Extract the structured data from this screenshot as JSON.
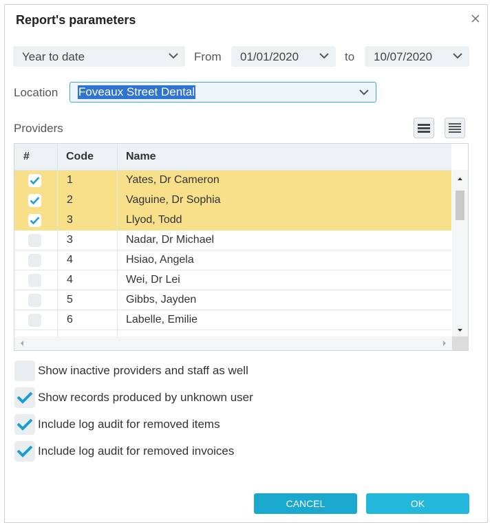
{
  "dialog": {
    "title": "Report's parameters"
  },
  "period": {
    "range": "Year to date",
    "from_label": "From",
    "from": "01/01/2020",
    "to_label": "to",
    "to": "10/07/2020"
  },
  "location": {
    "label": "Location",
    "value": "Foveaux Street Dental"
  },
  "providers": {
    "label": "Providers",
    "columns": {
      "check": "#",
      "code": "Code",
      "name": "Name"
    },
    "rows": [
      {
        "code": "1",
        "name": "Yates, Dr Cameron",
        "checked": true
      },
      {
        "code": "2",
        "name": "Vaguine, Dr Sophia",
        "checked": true
      },
      {
        "code": "3",
        "name": "Llyod, Todd",
        "checked": true
      },
      {
        "code": "3",
        "name": "Nadar, Dr Michael",
        "checked": false
      },
      {
        "code": "4",
        "name": "Hsiao, Angela",
        "checked": false
      },
      {
        "code": "4",
        "name": "Wei, Dr Lei",
        "checked": false
      },
      {
        "code": "5",
        "name": "Gibbs, Jayden",
        "checked": false
      },
      {
        "code": "6",
        "name": "Labelle, Emilie",
        "checked": false
      }
    ]
  },
  "options": [
    {
      "label": "Show inactive providers and staff as well",
      "checked": false
    },
    {
      "label": "Show records produced by unknown user",
      "checked": true
    },
    {
      "label": "Include log audit for removed items",
      "checked": true
    },
    {
      "label": "Include log audit for removed invoices",
      "checked": true
    }
  ],
  "buttons": {
    "cancel": "CANCEL",
    "ok": "OK"
  },
  "colors": {
    "accent": "#1ba8cf",
    "selected_row": "#f8df8a",
    "check": "#1a9fd0"
  }
}
